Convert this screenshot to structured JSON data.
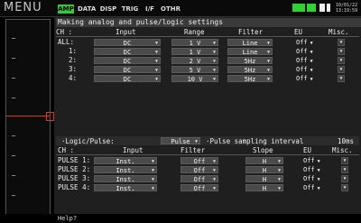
{
  "topbar": {
    "title": "MENU",
    "tabs": [
      "AMP",
      "DATA",
      "DISP",
      "TRIG",
      "I/F",
      "OTHR"
    ],
    "active_tab": "AMP",
    "clock": "10/01/22 13:19:59"
  },
  "heading": "Making analog and pulse/logic settings",
  "analog": {
    "headers": {
      "ch": "CH",
      "input": "Input",
      "range": "Range",
      "filter": "Filter",
      "eu": "EU",
      "misc": "Misc."
    },
    "rows": [
      {
        "ch": "ALL:",
        "input": "DC",
        "range": "1 V",
        "filter": "Line",
        "eu": "Off"
      },
      {
        "ch": "1:",
        "input": "DC",
        "range": "1 V",
        "filter": "Line",
        "eu": "Off"
      },
      {
        "ch": "2:",
        "input": "DC",
        "range": "2 V",
        "filter": "5Hz",
        "eu": "Off"
      },
      {
        "ch": "3:",
        "input": "DC",
        "range": "5 V",
        "filter": "5Hz",
        "eu": "Off"
      },
      {
        "ch": "4:",
        "input": "DC",
        "range": "10 V",
        "filter": "5Hz",
        "eu": "Off"
      }
    ]
  },
  "logic": {
    "label": "Logic/Pulse:",
    "mode": "Pulse",
    "interval_label": "Pulse sampling interval",
    "interval_value": "10ms",
    "headers": {
      "ch": "CH",
      "input": "Input",
      "filter": "Filter",
      "slope": "Slope",
      "eu": "EU",
      "misc": "Misc."
    },
    "rows": [
      {
        "ch": "PULSE 1:",
        "input": "Inst.",
        "filter": "Off",
        "slope": "H",
        "eu": "Off"
      },
      {
        "ch": "PULSE 2:",
        "input": "Inst.",
        "filter": "Off",
        "slope": "H",
        "eu": "Off"
      },
      {
        "ch": "PULSE 3:",
        "input": "Inst.",
        "filter": "Off",
        "slope": "H",
        "eu": "Off"
      },
      {
        "ch": "PULSE 4:",
        "input": "Inst.",
        "filter": "Off",
        "slope": "H",
        "eu": "Off"
      }
    ]
  },
  "help": "Help?",
  "colors": {
    "active_tab": "#37c837",
    "marker": "#e0381a",
    "dropdown": "#4a4a4a"
  },
  "icons": {
    "dropdown": "triangle-down-icon",
    "battery": "battery-icon",
    "card": "memory-card-icon"
  }
}
